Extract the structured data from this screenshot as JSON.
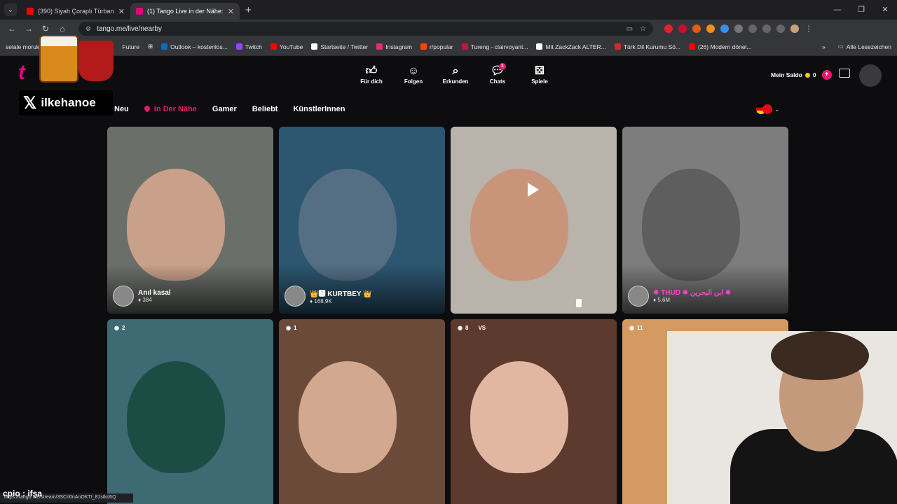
{
  "browser": {
    "tabs": [
      {
        "title": "(390) Siyah Çoraplı Türbanlı M...",
        "color": "#ff0000",
        "active": false
      },
      {
        "title": "(1) Tango Live in der Nähe: Spr...",
        "color": "#e6007e",
        "active": true
      }
    ],
    "url": "tango.me/live/nearby",
    "bookmarks": [
      {
        "label": "selale moruk"
      },
      {
        "label": "ki"
      },
      {
        "label": "idee"
      },
      {
        "label": "Future"
      },
      {
        "label": "Outlook – kostenlos..."
      },
      {
        "label": "Twitch"
      },
      {
        "label": "YouTube"
      },
      {
        "label": "Startseite / Twitter"
      },
      {
        "label": "Instagram"
      },
      {
        "label": "r/popular"
      },
      {
        "label": "Tureng - clairvoyant..."
      },
      {
        "label": "Mit ZackZack ALTER..."
      },
      {
        "label": "Türk Dil Kurumu Sö..."
      },
      {
        "label": "(26) Modern dönel..."
      }
    ],
    "all_bookmarks": "Alle Lesezeichen",
    "status_url": "https://tango.me/stream/3SCrl0nAnOKTt_81stkd6Q"
  },
  "topnav": {
    "items": [
      {
        "label": "Für dich",
        "icon": "thumbs-up-icon"
      },
      {
        "label": "Folgen",
        "icon": "people-icon"
      },
      {
        "label": "Erkunden",
        "icon": "search-icon"
      },
      {
        "label": "Chats",
        "icon": "chat-icon",
        "badge": "1"
      },
      {
        "label": "Spiele",
        "icon": "dice-icon"
      }
    ],
    "saldo_label": "Mein Saldo",
    "saldo_value": "0"
  },
  "categories": {
    "items": [
      "Neu",
      "In Der Nähe",
      "Gamer",
      "Beliebt",
      "KünstlerInnen"
    ],
    "active": "In Der Nähe"
  },
  "streams": [
    {
      "name": "Anıl kasal",
      "viewers": "384",
      "bg": "#6b6f6a"
    },
    {
      "name": "👑🆃 KURTBEY 👑",
      "viewers": "168,9K",
      "bg": "#2d5670"
    },
    {
      "name": "",
      "viewers": "",
      "bg": "#b9b3ab"
    },
    {
      "name": "✵ THUD ✵ ابن البحرين ✵",
      "viewers": "5,6M",
      "bg": "#7d7d7d"
    },
    {
      "name": "",
      "viewers": "2",
      "bg": "#3e6a73"
    },
    {
      "name": "",
      "viewers": "1",
      "bg": "#6b4a3a"
    },
    {
      "name": "",
      "viewers": "8",
      "vs": "VS",
      "bg": "#5d3a2e"
    },
    {
      "name": "",
      "viewers": "11",
      "bg": "#d59a62"
    }
  ],
  "overlay": {
    "brand": "ilkehanoe",
    "cpio": "cpio : ifşa"
  }
}
